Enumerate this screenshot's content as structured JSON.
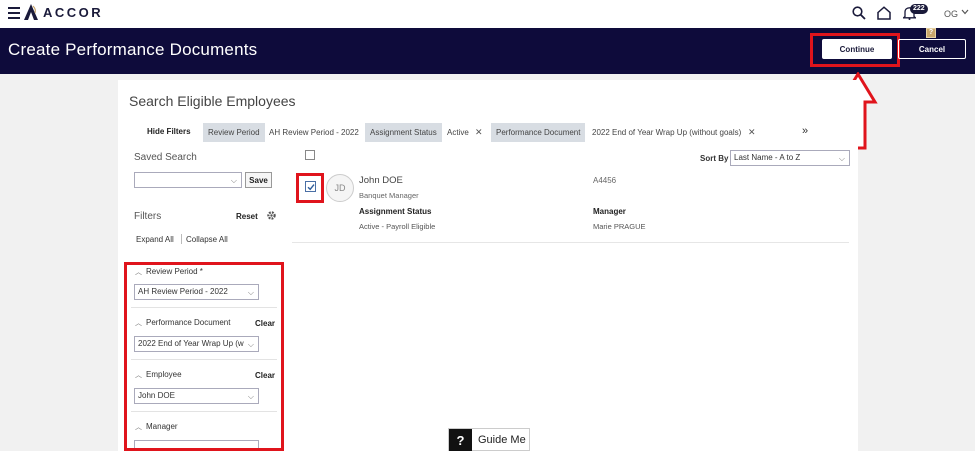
{
  "topbar": {
    "brand": "ACCOR",
    "notification_count": "222",
    "user_initials": "OG"
  },
  "header": {
    "title": "Create Performance Documents",
    "helper_badge": "?",
    "continue_label": "Continue",
    "cancel_label": "Cancel"
  },
  "search": {
    "title": "Search Eligible Employees",
    "hide_filters": "Hide Filters",
    "chips": [
      {
        "label": "Review Period",
        "value": "AH Review Period - 2022",
        "removable": false
      },
      {
        "label": "Assignment Status",
        "value": "Active",
        "removable": true
      },
      {
        "label": "Performance Document",
        "value": "2022 End of Year Wrap Up (without goals)",
        "removable": true
      }
    ],
    "more_icon": "»"
  },
  "saved_search": {
    "label": "Saved Search",
    "value": "",
    "save_label": "Save"
  },
  "filters": {
    "label": "Filters",
    "reset_label": "Reset",
    "expand_all": "Expand All",
    "collapse_all": "Collapse All",
    "groups": [
      {
        "title": "Review Period *",
        "value": "AH Review Period - 2022",
        "clear": ""
      },
      {
        "title": "Performance Document",
        "value": "2022 End of Year Wrap Up (w",
        "clear": "Clear"
      },
      {
        "title": "Employee",
        "value": "John DOE",
        "clear": "Clear"
      },
      {
        "title": "Manager",
        "value": "",
        "clear": ""
      }
    ]
  },
  "results": {
    "sort_by_label": "Sort By",
    "sort_by_value": "Last Name - A to Z",
    "employees": [
      {
        "initials": "JD",
        "name": "John DOE",
        "job": "Banquet Manager",
        "id": "A4456",
        "assignment_status_label": "Assignment Status",
        "assignment_status": "Active - Payroll Eligible",
        "manager_label": "Manager",
        "manager": "Marie PRAGUE",
        "selected": true
      }
    ]
  },
  "guide_me": {
    "icon": "?",
    "label": "Guide Me"
  },
  "colors": {
    "header_bg": "#0e0b3b",
    "highlight_red": "#e0141c",
    "chip_bg": "#d8dde3"
  }
}
